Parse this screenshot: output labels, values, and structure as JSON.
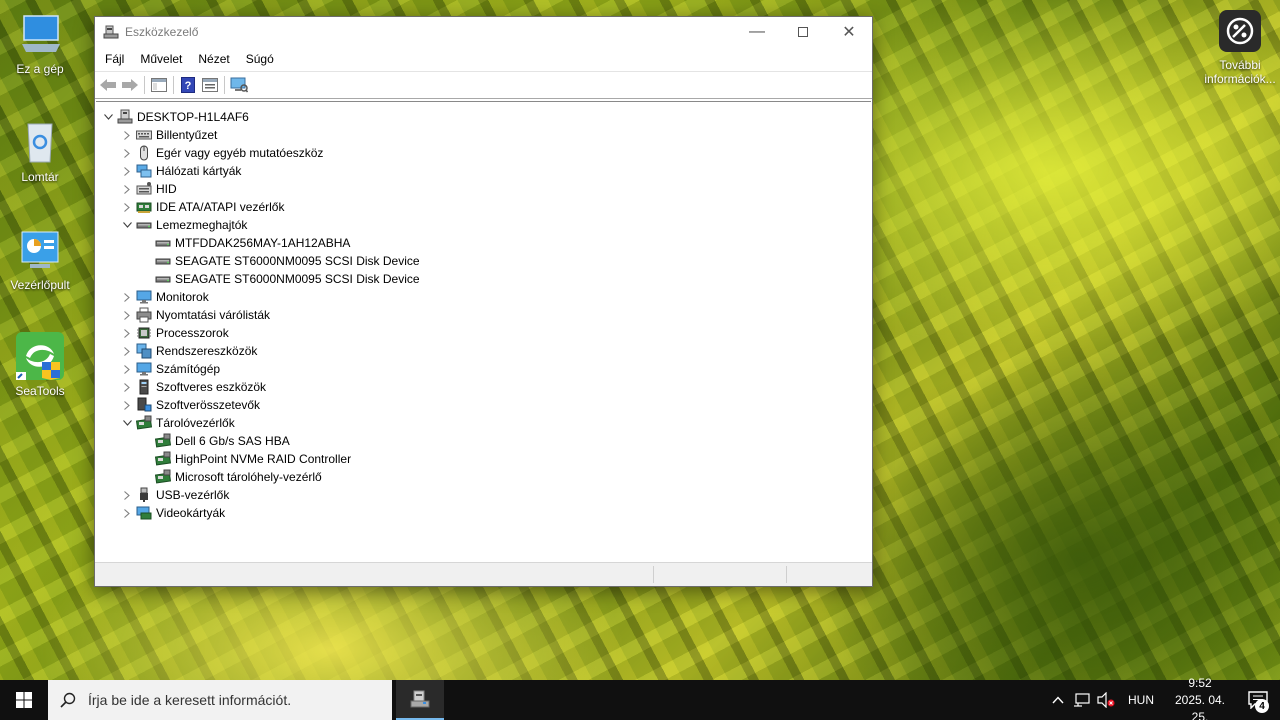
{
  "desktop": {
    "icons": [
      {
        "label": "Ez a gép"
      },
      {
        "label": "Lomtár"
      },
      {
        "label": "Vezérlőpult"
      },
      {
        "label": "SeaTools"
      }
    ],
    "info_label": "További információk..."
  },
  "window": {
    "title": "Eszközkezelő",
    "menu": [
      "Fájl",
      "Művelet",
      "Nézet",
      "Súgó"
    ]
  },
  "tree": [
    {
      "label": "DESKTOP-H1L4AF6",
      "level": 0,
      "expander": "expanded",
      "icon": "computer-icon"
    },
    {
      "label": "Billentyűzet",
      "level": 1,
      "expander": "collapsed",
      "icon": "keyboard-icon"
    },
    {
      "label": "Egér vagy egyéb mutatóeszköz",
      "level": 1,
      "expander": "collapsed",
      "icon": "mouse-icon"
    },
    {
      "label": "Hálózati kártyák",
      "level": 1,
      "expander": "collapsed",
      "icon": "network-adapter-icon"
    },
    {
      "label": "HID",
      "level": 1,
      "expander": "collapsed",
      "icon": "hid-icon"
    },
    {
      "label": "IDE ATA/ATAPI vezérlők",
      "level": 1,
      "expander": "collapsed",
      "icon": "ide-controller-icon"
    },
    {
      "label": "Lemezmeghajtók",
      "level": 1,
      "expander": "expanded",
      "icon": "disk-drive-icon"
    },
    {
      "label": "MTFDDAK256MAY-1AH12ABHA",
      "level": 2,
      "expander": "none",
      "icon": "disk-drive-icon"
    },
    {
      "label": "SEAGATE ST6000NM0095 SCSI Disk Device",
      "level": 2,
      "expander": "none",
      "icon": "disk-drive-icon"
    },
    {
      "label": "SEAGATE ST6000NM0095 SCSI Disk Device",
      "level": 2,
      "expander": "none",
      "icon": "disk-drive-icon"
    },
    {
      "label": "Monitorok",
      "level": 1,
      "expander": "collapsed",
      "icon": "monitor-icon"
    },
    {
      "label": "Nyomtatási várólisták",
      "level": 1,
      "expander": "collapsed",
      "icon": "printer-icon"
    },
    {
      "label": "Processzorok",
      "level": 1,
      "expander": "collapsed",
      "icon": "processor-icon"
    },
    {
      "label": "Rendszereszközök",
      "level": 1,
      "expander": "collapsed",
      "icon": "system-devices-icon"
    },
    {
      "label": "Számítógép",
      "level": 1,
      "expander": "collapsed",
      "icon": "monitor-icon"
    },
    {
      "label": "Szoftveres eszközök",
      "level": 1,
      "expander": "collapsed",
      "icon": "software-device-icon"
    },
    {
      "label": "Szoftverösszetevők",
      "level": 1,
      "expander": "collapsed",
      "icon": "software-component-icon"
    },
    {
      "label": "Tárolóvezérlők",
      "level": 1,
      "expander": "expanded",
      "icon": "storage-controller-icon"
    },
    {
      "label": "Dell 6 Gb/s SAS HBA",
      "level": 2,
      "expander": "none",
      "icon": "storage-controller-icon"
    },
    {
      "label": "HighPoint NVMe RAID Controller",
      "level": 2,
      "expander": "none",
      "icon": "storage-controller-icon"
    },
    {
      "label": "Microsoft tárolóhely-vezérlő",
      "level": 2,
      "expander": "none",
      "icon": "storage-controller-icon"
    },
    {
      "label": "USB-vezérlők",
      "level": 1,
      "expander": "collapsed",
      "icon": "usb-icon"
    },
    {
      "label": "Videokártyák",
      "level": 1,
      "expander": "collapsed",
      "icon": "display-adapter-icon"
    }
  ],
  "taskbar": {
    "search_placeholder": "Írja be ide a keresett információt.",
    "language": "HUN",
    "time": "9:52",
    "date": "2025. 04. 25.",
    "notification_count": "4"
  }
}
